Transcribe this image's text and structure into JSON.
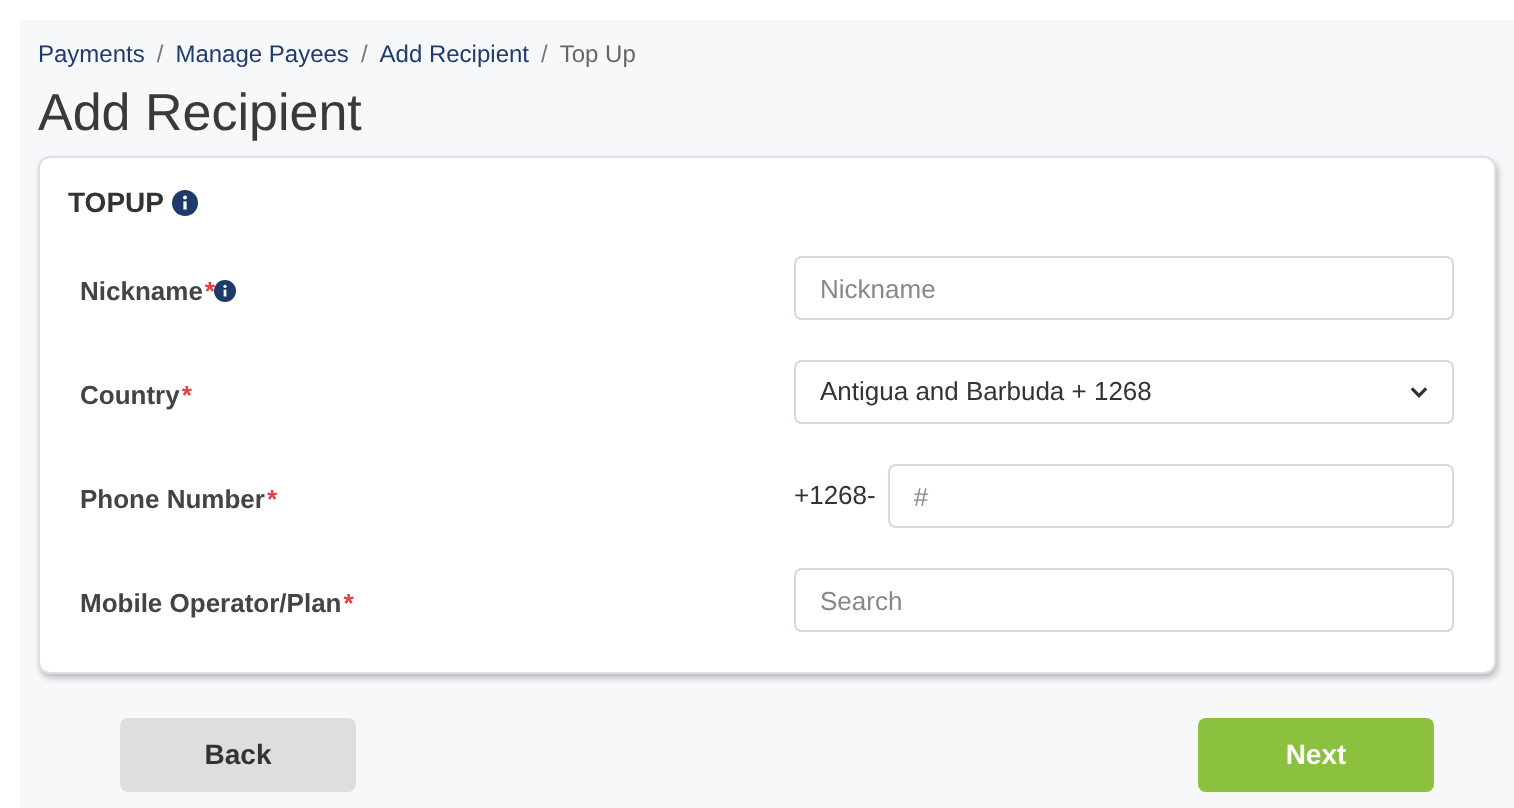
{
  "breadcrumb": {
    "separator": "/",
    "items": [
      {
        "label": "Payments",
        "current": false
      },
      {
        "label": "Manage Payees",
        "current": false
      },
      {
        "label": "Add Recipient",
        "current": false
      },
      {
        "label": "Top Up",
        "current": true
      }
    ]
  },
  "title": "Add Recipient",
  "section": {
    "title": "TOPUP",
    "info": true
  },
  "fields": [
    {
      "kind": "text",
      "label": "Nickname",
      "mark": "*",
      "info": true,
      "placeholder": "Nickname"
    },
    {
      "kind": "select",
      "label": "Country",
      "mark": "*",
      "info": false,
      "value": "Antigua and Barbuda + 1268"
    },
    {
      "kind": "phone",
      "label": "Phone Number",
      "mark": "*",
      "info": false,
      "prefix": "+1268-",
      "placeholder": "#"
    },
    {
      "kind": "text",
      "label": "Mobile Operator/Plan",
      "mark": "*",
      "info": false,
      "placeholder": "Search"
    }
  ],
  "buttons": [
    {
      "kind": "secondary",
      "label": "Back"
    },
    {
      "kind": "primary",
      "label": "Next"
    }
  ]
}
